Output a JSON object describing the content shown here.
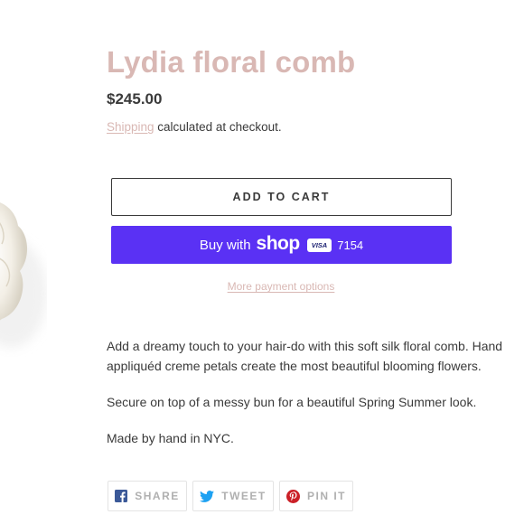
{
  "product": {
    "title": "Lydia floral comb",
    "price": "$245.00",
    "shipping_link": "Shipping",
    "shipping_suffix": " calculated at checkout."
  },
  "buttons": {
    "add_to_cart": "ADD TO CART",
    "buy_with_prefix": "Buy with",
    "shop_logo": "shop",
    "card_brand": "VISA",
    "card_last4": "7154",
    "more_payment_options": "More payment options"
  },
  "description": {
    "paragraphs": [
      "Add a dreamy touch to your hair-do with this soft silk floral comb. Hand appliquéd creme petals create the most beautiful blooming flowers.",
      "Secure on top of a messy bun for a beautiful Spring Summer look.",
      "Made by hand in NYC."
    ]
  },
  "share": {
    "facebook": "SHARE",
    "twitter": "TWEET",
    "pinterest": "PIN IT"
  },
  "colors": {
    "accent": "#d9b8b4",
    "shop_pay": "#5a31f4",
    "text": "#3a3a3a"
  },
  "icons": [
    "facebook-icon",
    "twitter-icon",
    "pinterest-icon",
    "visa-icon"
  ]
}
